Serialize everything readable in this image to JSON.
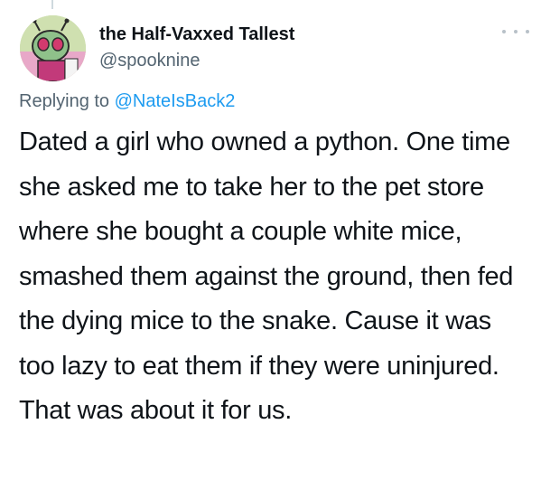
{
  "tweet": {
    "author": {
      "display_name": "the Half-Vaxxed Tallest",
      "handle": "@spooknine",
      "avatar": "cartoon-character-avatar"
    },
    "more_icon": "more-options-icon",
    "replying_prefix": "Replying to",
    "replying_to": "@NateIsBack2",
    "text": "Dated a girl who owned a python. One time she asked me to take her to the pet store where she bought a couple white mice, smashed them against the ground, then fed the dying mice to the snake. Cause it was too lazy to eat them if they were uninjured. That was about it for us."
  },
  "colors": {
    "text_primary": "#0f1419",
    "text_secondary": "#536471",
    "link": "#1d9bf0"
  }
}
